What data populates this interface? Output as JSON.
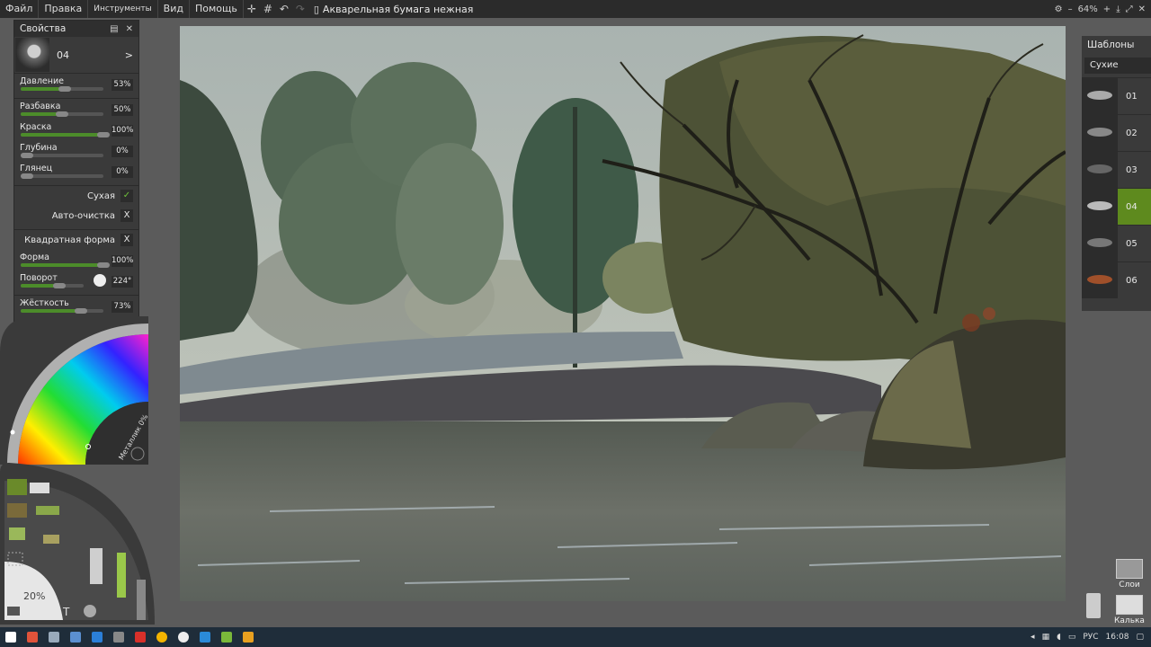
{
  "menu": {
    "items": [
      "Файл",
      "Правка",
      "Инструменты",
      "Вид",
      "Помощь"
    ],
    "document_title": "Акварельная бумага нежная",
    "zoom": "64%"
  },
  "properties": {
    "title": "Свойства",
    "brush_name": "04",
    "sliders": [
      {
        "label": "Давление",
        "value": "53%",
        "fraction": 0.53
      },
      {
        "label": "Разбавка",
        "value": "50%",
        "fraction": 0.5
      },
      {
        "label": "Краска",
        "value": "100%",
        "fraction": 1.0
      },
      {
        "label": "Глубина",
        "value": "0%",
        "fraction": 0.0
      },
      {
        "label": "Глянец",
        "value": "0%",
        "fraction": 0.0
      }
    ],
    "dry": {
      "label": "Сухая",
      "mark": "✓"
    },
    "autoclean": {
      "label": "Авто-очистка",
      "mark": "X"
    },
    "square": {
      "label": "Квадратная форма",
      "mark": "X"
    },
    "shape": {
      "label": "Форма",
      "value": "100%",
      "fraction": 1.0
    },
    "rotation": {
      "label": "Поворот",
      "value": "224°",
      "fraction": 0.62
    },
    "hardness": {
      "label": "Жёсткость",
      "value": "73%",
      "fraction": 0.73
    }
  },
  "color_picker": {
    "metallic_label": "Металлик 0%"
  },
  "toolwheel": {
    "size_label": "20%"
  },
  "templates": {
    "title": "Шаблоны",
    "category": "Сухие",
    "items": [
      "01",
      "02",
      "03",
      "04",
      "05",
      "06"
    ],
    "active": "04"
  },
  "side_buttons": {
    "layers": "Слои",
    "tracing": "Калька"
  },
  "taskbar": {
    "lang": "РУС",
    "time": "16:08"
  },
  "colors": {
    "accent": "#5e8a1e",
    "panel": "#3a3a3a",
    "menubar": "#2b2b2b"
  }
}
